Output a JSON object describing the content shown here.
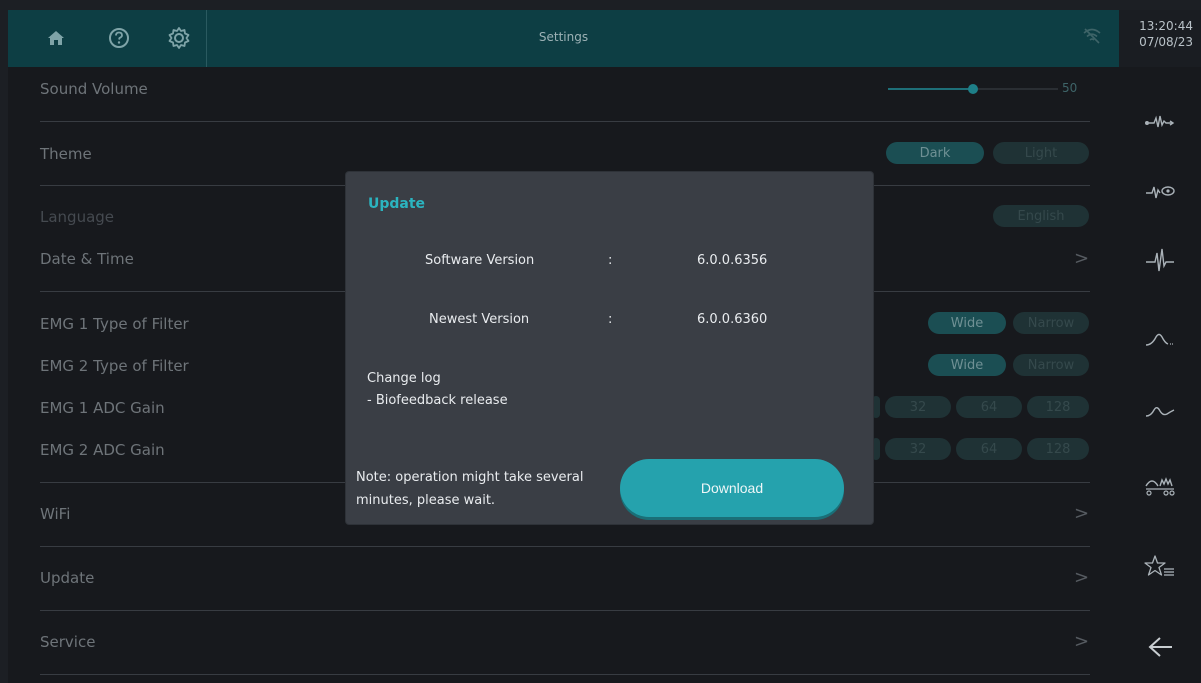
{
  "header": {
    "title": "Settings",
    "time": "13:20:44",
    "date": "07/08/23",
    "icons": [
      "home-icon",
      "help-icon",
      "settings-gear-icon",
      "wifi-off-icon"
    ]
  },
  "settings": {
    "sound_volume": {
      "label": "Sound Volume",
      "value": "50",
      "level": 0.5
    },
    "theme": {
      "label": "Theme",
      "options": [
        "Dark",
        "Light"
      ],
      "selected": "Dark"
    },
    "language": {
      "label": "Language",
      "value": "English"
    },
    "date_time": {
      "label": "Date & Time"
    },
    "emg1_filter": {
      "label": "EMG 1 Type of Filter",
      "options": [
        "Wide",
        "Narrow"
      ],
      "selected": "Wide"
    },
    "emg2_filter": {
      "label": "EMG 2 Type of Filter",
      "options": [
        "Wide",
        "Narrow"
      ],
      "selected": "Wide"
    },
    "emg1_gain": {
      "label": "EMG 1 ADC Gain",
      "options": [
        "32",
        "64",
        "128"
      ]
    },
    "emg2_gain": {
      "label": "EMG 2 ADC Gain",
      "options": [
        "32",
        "64",
        "128"
      ]
    },
    "wifi": {
      "label": "WiFi"
    },
    "update": {
      "label": "Update"
    },
    "service": {
      "label": "Service"
    },
    "chevron": ">"
  },
  "sidebar": {
    "icons": [
      "emg-signal-icon",
      "emg-eye-icon",
      "emg-pulse-icon",
      "curve-icon",
      "wave-icon",
      "chart-people-icon",
      "favorites-list-icon",
      "back-arrow-icon"
    ]
  },
  "modal": {
    "title": "Update",
    "software_version_label": "Software Version",
    "software_version_value": "6.0.0.6356",
    "newest_version_label": "Newest Version",
    "newest_version_value": "6.0.0.6360",
    "separator": ":",
    "changelog_title": "Change log",
    "changelog_item": "- Biofeedback release",
    "note_line1": "Note: operation might take several",
    "note_line2": "minutes, please wait.",
    "download_label": "Download"
  },
  "colors": {
    "accent": "#25a2ad",
    "topbar": "#0d3e44",
    "background": "#17191d",
    "modal": "#3a3e45"
  }
}
